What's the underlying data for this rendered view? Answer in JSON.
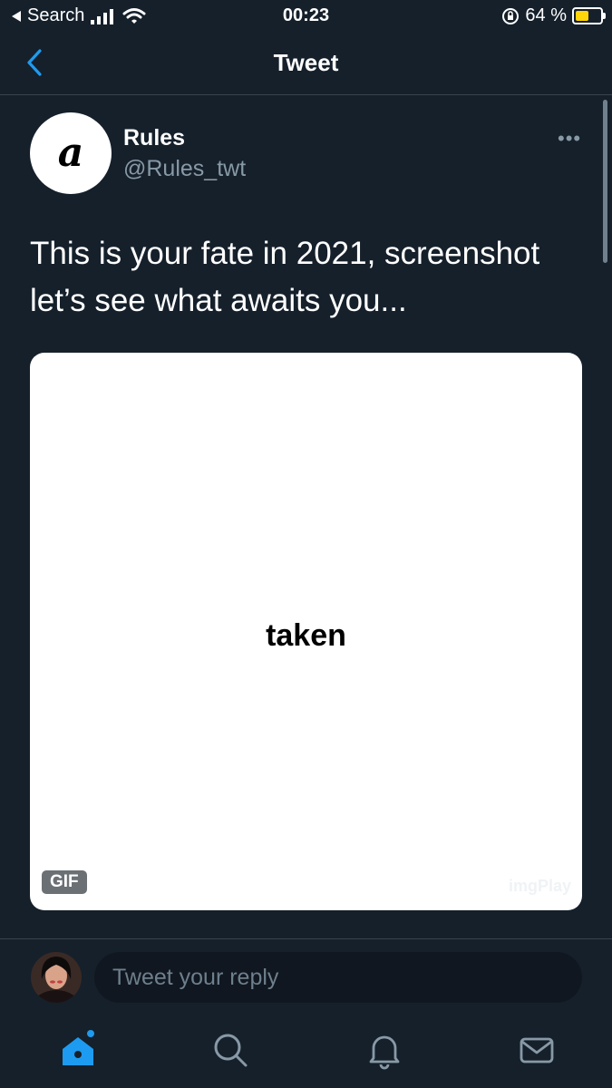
{
  "status_bar": {
    "back_label": "Search",
    "time": "00:23",
    "battery_percent": 64,
    "battery_label": "64 %"
  },
  "header": {
    "title": "Tweet",
    "back_icon": "chevron-left-icon"
  },
  "tweet": {
    "author_name": "Rules",
    "author_handle": "@Rules_twt",
    "avatar_letter": "a",
    "text_line1": "This is your fate in 2021, screenshot",
    "text_line2": "let’s see what awaits you...",
    "media": {
      "word": "taken",
      "badge": "GIF",
      "watermark": "imgPlay"
    }
  },
  "reply": {
    "placeholder": "Tweet your reply"
  },
  "tab_bar": {
    "items": [
      "home-icon",
      "search-icon",
      "bell-icon",
      "mail-icon"
    ]
  },
  "colors": {
    "background": "#15202b",
    "accent": "#1d9bf0",
    "secondary_text": "#8899a6"
  }
}
